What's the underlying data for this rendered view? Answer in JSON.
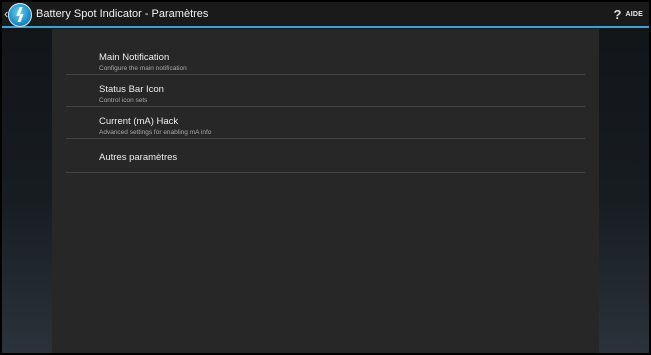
{
  "actionbar": {
    "title": "Battery Spot Indicator - Paramètres",
    "help_label": "AIDE",
    "help_icon": "?"
  },
  "settings": {
    "items": [
      {
        "title": "Main Notification",
        "summary": "Configure the main notification"
      },
      {
        "title": "Status Bar Icon",
        "summary": "Control icon sets"
      },
      {
        "title": "Current (mA) Hack",
        "summary": "Advanced settings for enabling mA info"
      },
      {
        "title": "Autres paramètres",
        "summary": ""
      }
    ]
  },
  "colors": {
    "accent": "#2fa8d6",
    "panel_bg": "#272727",
    "divider": "#444444"
  }
}
